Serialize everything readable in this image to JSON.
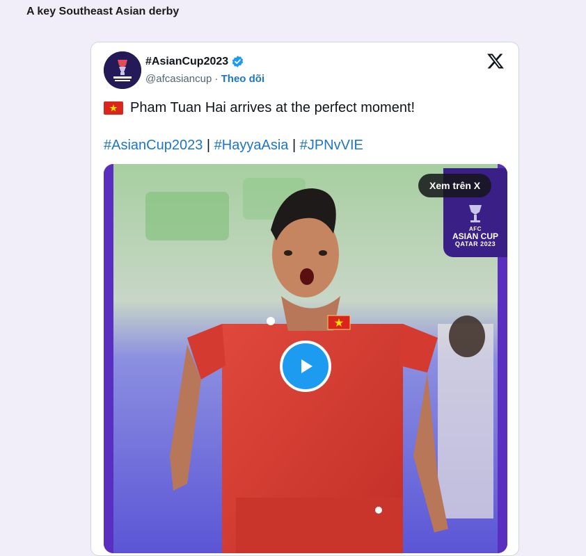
{
  "article": {
    "heading": "A key Southeast Asian derby"
  },
  "tweet": {
    "display_name": "#AsianCup2023",
    "handle": "@afcasiancup",
    "separator": "·",
    "follow_label": "Theo dõi",
    "text": "Pham Tuan Hai arrives at the perfect moment!",
    "hashtags": [
      "#AsianCup2023",
      "#HayyaAsia",
      "#JPNvVIE"
    ],
    "hashtag_separator": "|",
    "media": {
      "view_label": "Xem trên X",
      "badge": {
        "line1": "AFC",
        "line2": "ASIAN CUP",
        "line3": "QATAR 2023"
      }
    },
    "icons": {
      "avatar": "afc-asian-cup-logo",
      "verified": "verified-badge-icon",
      "platform": "x-logo-icon",
      "flag": "vietnam-flag-icon",
      "play": "play-icon"
    }
  },
  "colors": {
    "page_bg": "#f1eefa",
    "link": "#1d75c9",
    "verified": "#1d9bf0",
    "play_button": "#1d9bf0",
    "jersey": "#d63a2f",
    "badge_bg": "#3a1f86"
  }
}
